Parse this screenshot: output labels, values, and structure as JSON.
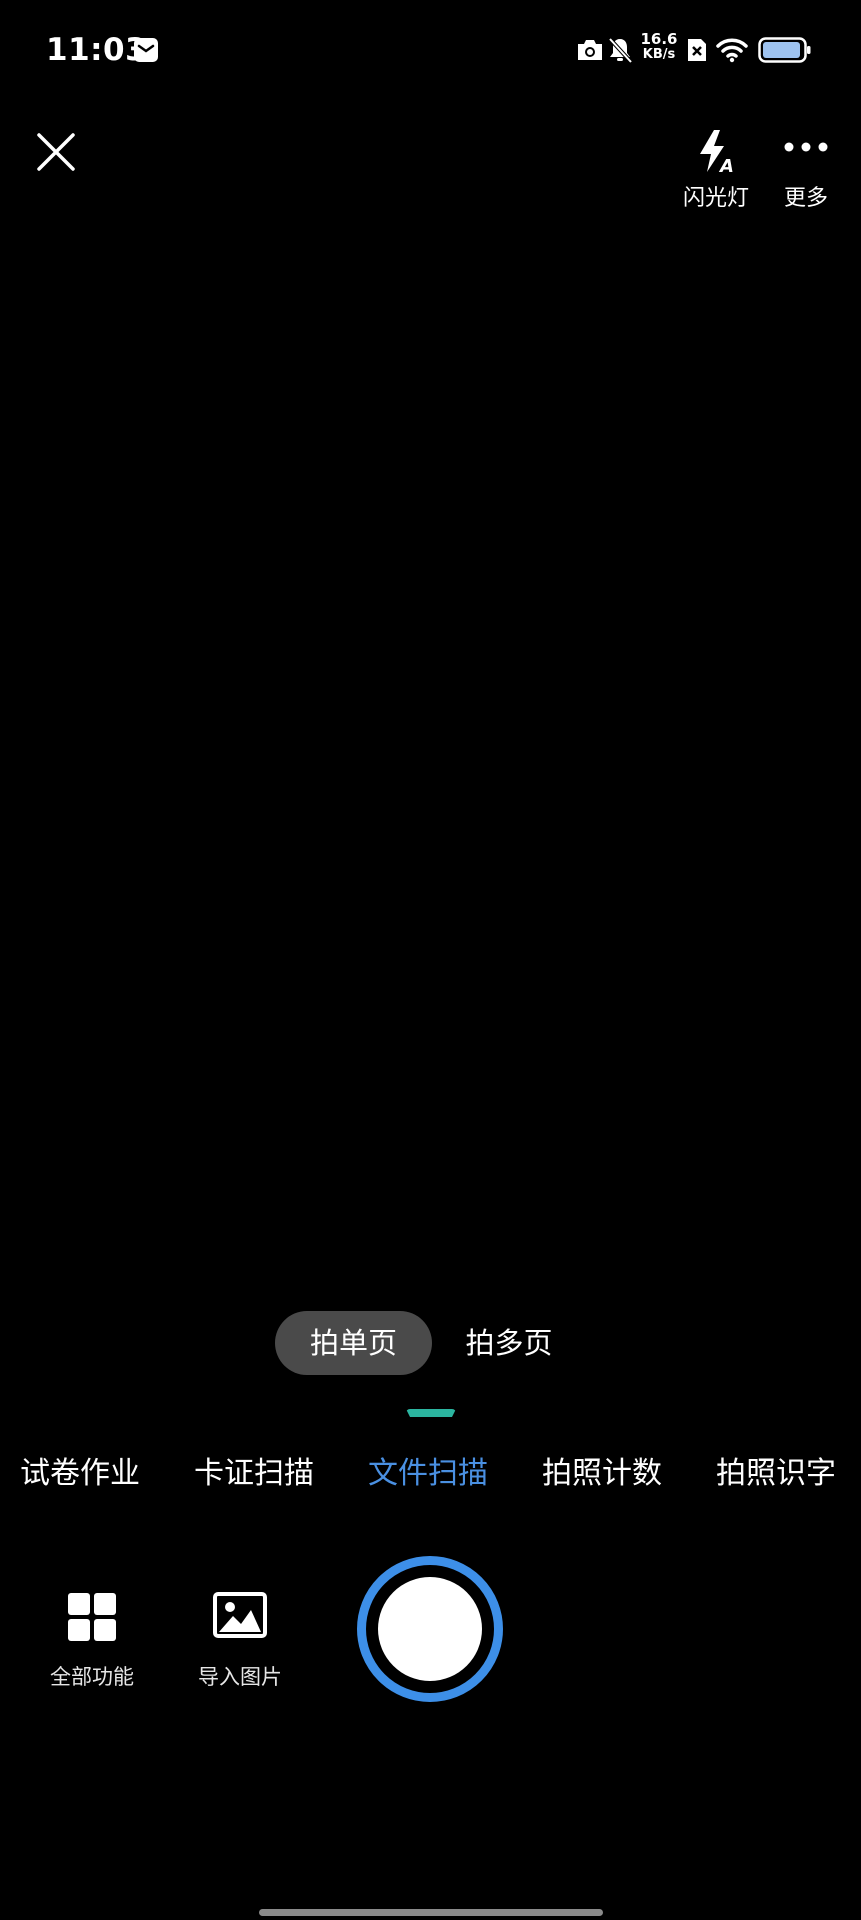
{
  "status_bar": {
    "time": "11:03",
    "network_speed_value": "16.6",
    "network_speed_unit": "KB/s",
    "icons": [
      "message-icon",
      "camera-icon",
      "mute-bell-icon",
      "sim-off-icon",
      "wifi-icon",
      "battery-icon"
    ]
  },
  "top_bar": {
    "close_icon": "close-icon",
    "flash_label": "闪光灯",
    "flash_icon": "flash-auto-icon",
    "more_label": "更多",
    "more_icon": "more-dots-icon"
  },
  "page_mode": {
    "single_label": "拍单页",
    "multi_label": "拍多页",
    "selected": "single"
  },
  "scan_tabs": [
    {
      "label": "试卷作业"
    },
    {
      "label": "卡证扫描"
    },
    {
      "label": "文件扫描",
      "active": true
    },
    {
      "label": "拍照计数"
    },
    {
      "label": "拍照识字"
    }
  ],
  "bottom_tools": {
    "all_features_label": "全部功能",
    "import_image_label": "导入图片"
  },
  "colors": {
    "active_tab": "#4a90e2",
    "shutter_ring": "#3d8fe8",
    "indicator": "#2bb5a0",
    "mode_pill": "#4a4a4a"
  }
}
